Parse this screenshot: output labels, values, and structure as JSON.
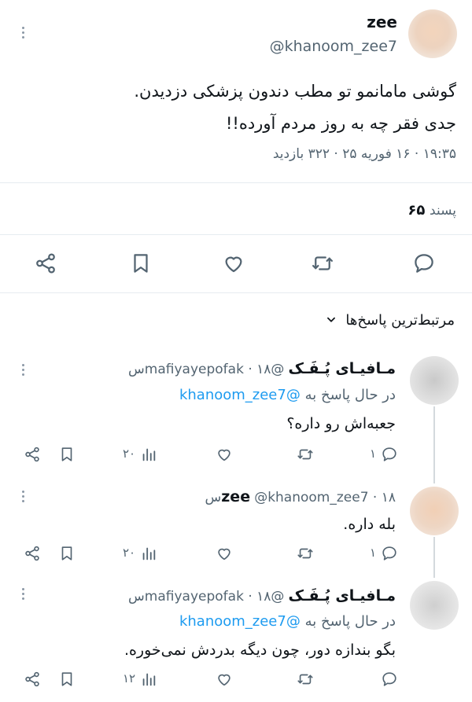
{
  "tweet": {
    "display_name": "zee",
    "handle": "@khanoom_zee7",
    "text_line1": "گوشی مامانمو تو مطب دندون پزشکی دزدیدن.",
    "text_line2": "جدی فقر چه به روز مردم آورده!!",
    "meta": "۱۹:۳۵ · ۱۶ فوریه ۲۵ · ۳۲۲ بازدید",
    "likes_count": "۶۵",
    "likes_label": "پسند",
    "actions": [
      "reply-icon",
      "retweet-icon",
      "like-icon",
      "bookmark-icon",
      "share-icon"
    ]
  },
  "replies_sort": {
    "label": "مرتبط‌ترین پاسخ‌ها",
    "icon": "chevron-down-icon"
  },
  "replies": [
    {
      "name": "مـافیـای پُـفَـک",
      "handle_time": "@mafiyayepofak · ۱۸س",
      "replying_to_prefix": "در حال پاسخ به",
      "replying_to_handle": "@khanoom_zee7",
      "text": "جعبه‌اش رو داره؟",
      "views": "۲۰",
      "reply_count": "۱"
    },
    {
      "name": "zee",
      "handle_time": "@khanoom_zee7 · ۱۸س",
      "text": "بله داره.",
      "views": "۲۰",
      "reply_count": "۱"
    },
    {
      "name": "مـافیـای پُـفَـک",
      "handle_time": "@mafiyayepofak · ۱۸س",
      "replying_to_prefix": "در حال پاسخ به",
      "replying_to_handle": "@khanoom_zee7",
      "text": "بگو بندازه دور، چون دیگه بدردش نمی‌خوره.",
      "views": "۱۲",
      "reply_count": ""
    }
  ],
  "colors": {
    "text": "#0f1419",
    "secondary": "#536471",
    "link": "#1d9bf0",
    "border": "#e6ecf0"
  }
}
